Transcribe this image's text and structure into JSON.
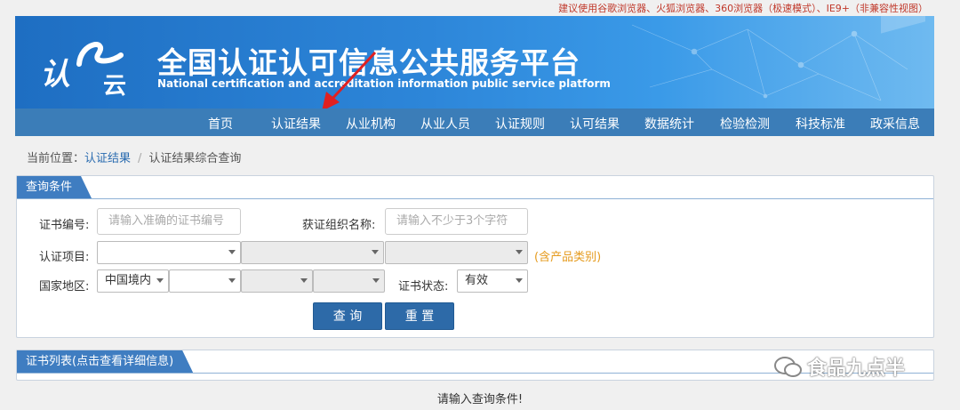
{
  "top_notice": "建议使用谷歌浏览器、火狐浏览器、360浏览器（极速模式）、IE9+（非兼容性视图）",
  "header": {
    "title": "全国认证认可信息公共服务平台",
    "subtitle": "National certification and accreditation information public service platform",
    "logo_text_left": "认",
    "logo_text_right": "云"
  },
  "nav": [
    "首页",
    "认证结果",
    "从业机构",
    "从业人员",
    "认证规则",
    "认可结果",
    "数据统计",
    "检验检测",
    "科技标准",
    "政采信息"
  ],
  "breadcrumb": {
    "label": "当前位置：",
    "link": "认证结果",
    "current": "认证结果综合查询"
  },
  "query": {
    "tab": "查询条件",
    "cert_no_label": "证书编号:",
    "cert_no_placeholder": "请输入准确的证书编号",
    "org_label": "获证组织名称:",
    "org_placeholder": "请输入不少于3个字符",
    "project_label": "认证项目:",
    "project_note": "(含产品类别)",
    "region_label": "国家地区:",
    "region_value": "中国境内",
    "status_label": "证书状态:",
    "status_value": "有效",
    "search_button": "查 询",
    "reset_button": "重 置"
  },
  "list": {
    "tab": "证书列表(点击查看详细信息)",
    "empty_message": "请输入查询条件!"
  },
  "watermark": "食品九点半"
}
